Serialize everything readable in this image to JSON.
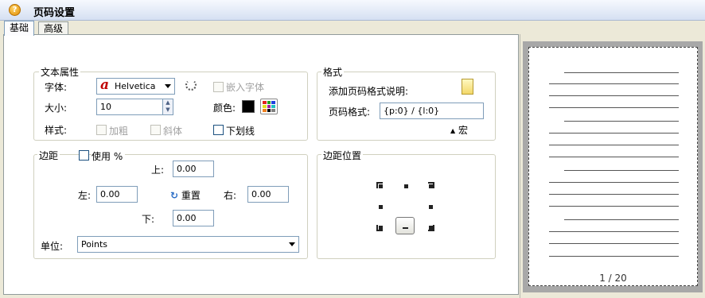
{
  "title_bar": {
    "title": "页码设置"
  },
  "tabs": [
    {
      "label": "基础"
    },
    {
      "label": "高级"
    }
  ],
  "text_props": {
    "legend": "文本属性",
    "font_label": "字体:",
    "font_value": "Helvetica",
    "embed_label": "嵌入字体",
    "size_label": "大小:",
    "size_value": "10",
    "color_label": "颜色:",
    "style_label": "样式:",
    "bold_label": "加粗",
    "italic_label": "斜体",
    "underline_label": "下划线"
  },
  "format": {
    "legend": "格式",
    "add_desc_label": "添加页码格式说明:",
    "page_format_label": "页码格式:",
    "page_format_value": "{p:0} / {l:0}",
    "macro_label": "宏"
  },
  "margins": {
    "legend": "边距",
    "use_percent_label": "使用 %",
    "top_label": "上:",
    "top_value": "0.00",
    "left_label": "左:",
    "left_value": "0.00",
    "reset_label": "重置",
    "right_label": "右:",
    "right_value": "0.00",
    "bottom_label": "下:",
    "bottom_value": "0.00",
    "unit_label": "单位:",
    "unit_value": "Points"
  },
  "margin_position": {
    "legend": "边距位置"
  },
  "preview": {
    "page_number": "1 / 20"
  },
  "colors": {
    "accent": "#1c5180",
    "title_bar": "#d5e0f2",
    "font_icon": "#c00000"
  }
}
